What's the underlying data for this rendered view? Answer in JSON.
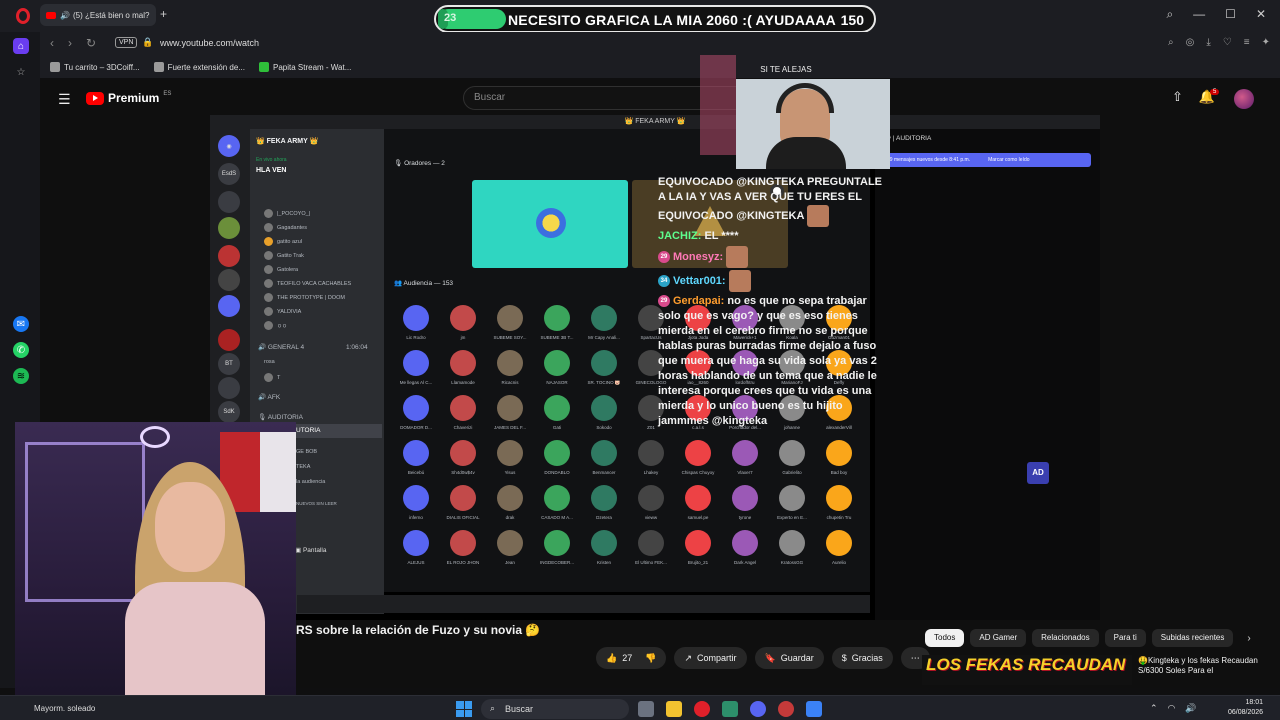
{
  "browser": {
    "tab_title": "(5) ¿Está bien o mal?",
    "url": "www.youtube.com/watch",
    "vpn_label": "VPN",
    "bookmarks": [
      "Tu carrito – 3DCoiff...",
      "Fuerte extensión de...",
      "Papita Stream - Wat..."
    ]
  },
  "donation": {
    "count": "23",
    "message": "NECESITO GRAFICA LA MIA 2060 :( AYUDAAAA",
    "amount": "150",
    "progress": 0.15
  },
  "youtube": {
    "logo_text": "Premium",
    "logo_region": "ES",
    "search_placeholder": "Buscar",
    "notification_count": "5"
  },
  "discord": {
    "title": "👑 FEKA ARMY 👑",
    "server_name": "👑 FEKA ARMY 👑",
    "live_label": "En vivo ahora",
    "hla_ven": "HLA VEN",
    "channel_members": [
      "|_POCOYO_|",
      "Gagadantes",
      "gatito azul",
      "Gatito Trak",
      "Gatolera",
      "TEOFILO VACA CACHABLES",
      "THE PROTOTYPE | DOOM",
      "YALDIVIA",
      "ㅇㅇ"
    ],
    "general_label": "GENERAL 4",
    "general_time": "1:06:04",
    "general_members": [
      "rosa",
      "T"
    ],
    "afk_label": "AFK",
    "auditoria_label": "AUDITORIA",
    "selected_channel": "UTORIA",
    "side_rows": [
      "GE BOB",
      "TEKA",
      "la audiencia",
      "NUEVOS SIN LEER"
    ],
    "screen_share": "Pantalla",
    "speakers_label": "Oradores — 2",
    "audience_label": "Audiencia — 153",
    "audience": [
      "Lic Rodro",
      "jm",
      "SUBEME SOY...",
      "SUBEME 3B T...",
      "Mr Capy Anali...",
      "SpartacUs",
      "Jjota Joda",
      "Maverick+1",
      "Koala",
      "Guzman01",
      "Me llegas Al C...",
      "Llamamode",
      "Ricacnis",
      "NAJASOR",
      "SR. TOCINO 🐷",
      "GINECOLOGO",
      "iao__8260",
      "lordofhtru",
      "MarianoFJ",
      "Deffy",
      "DOMADOR D...",
      "Chaverizi",
      "JAMES DEL F...",
      "Gati",
      "Sokodo",
      "Z01",
      "c.a.l.s",
      "Porchador del...",
      "johanne",
      "alexanderVill",
      "Beicebú",
      "Sh4d0w$4v",
      "Yisus",
      "DONDABLO",
      "Benmancer",
      "Lhakey",
      "Chispas Chuyoy",
      "Vlaxer7",
      "Gabrielito",
      "Bad boy",
      "inferno",
      "DIALIS OFICIAL",
      "drak",
      "CASADO M A...",
      "Dzetera",
      "vieww",
      "samuel.pe",
      "tyrone",
      "Experto en E...",
      "chupetin Tru",
      "ALEJUS",
      "EL ROJO JHON",
      "Jean",
      "INGDECOBER...",
      "Kristen",
      "El Ultimo FEK...",
      "Brujito_21",
      "Dark Angel",
      "KratossGG",
      "Aurelio"
    ]
  },
  "chat": {
    "header": "| AUDITORIA",
    "banner": "19 mensajes nuevos desde 8:41 p.m.",
    "banner_action": "Marcar como leído",
    "cam_caption": "SI TE ALEJAS",
    "messages": [
      {
        "user": "",
        "text": "EQUIVOCADO @KINGTEKA PREGUNTALE A LA IA Y VAS A VER QUE TU ERES EL EQUIVOCADO @KINGTEKA"
      },
      {
        "user": "JACHIZ:",
        "text": "EL ****"
      },
      {
        "user": "Monesyz:",
        "text": ""
      },
      {
        "user": "Vettar001:",
        "text": ""
      },
      {
        "user": "Gerdapai:",
        "text": "no es que no sepa trabajar solo que es vago? y que es eso tienes mierda en el cerebro firme no se porque hablas puras burradas firme dejalo a fuso que muera que haga su vida sola ya vas 2 horas hablando de un tema que a nadie le interesa porque crees que tu vida es una mierda y lo unico bueno es tu hijito jammmes @kingteka"
      }
    ],
    "badges": [
      "29",
      "34",
      "29"
    ]
  },
  "video": {
    "title": "RS sobre la relación de Fuzo y su novia 🤔",
    "likes": "27",
    "share": "Compartir",
    "save": "Guardar",
    "thanks": "Gracias",
    "more": "⋯"
  },
  "chips": [
    "Todos",
    "AD Gamer",
    "Relacionados",
    "Para ti",
    "Subidas recientes"
  ],
  "recommendation": {
    "thumb_text": "LOS FEKAS RECAUDAN",
    "title": "🤑Kingteka y los fekas Recaudan S/6300 Soles Para el"
  },
  "taskbar": {
    "weather": "Mayorm. soleado",
    "search": "Buscar",
    "time": "18:01",
    "date": "06/08/2026"
  },
  "colors": {
    "accent_green": "#2ecc71",
    "discord_blurple": "#5865f2",
    "youtube_red": "#ff0000"
  }
}
